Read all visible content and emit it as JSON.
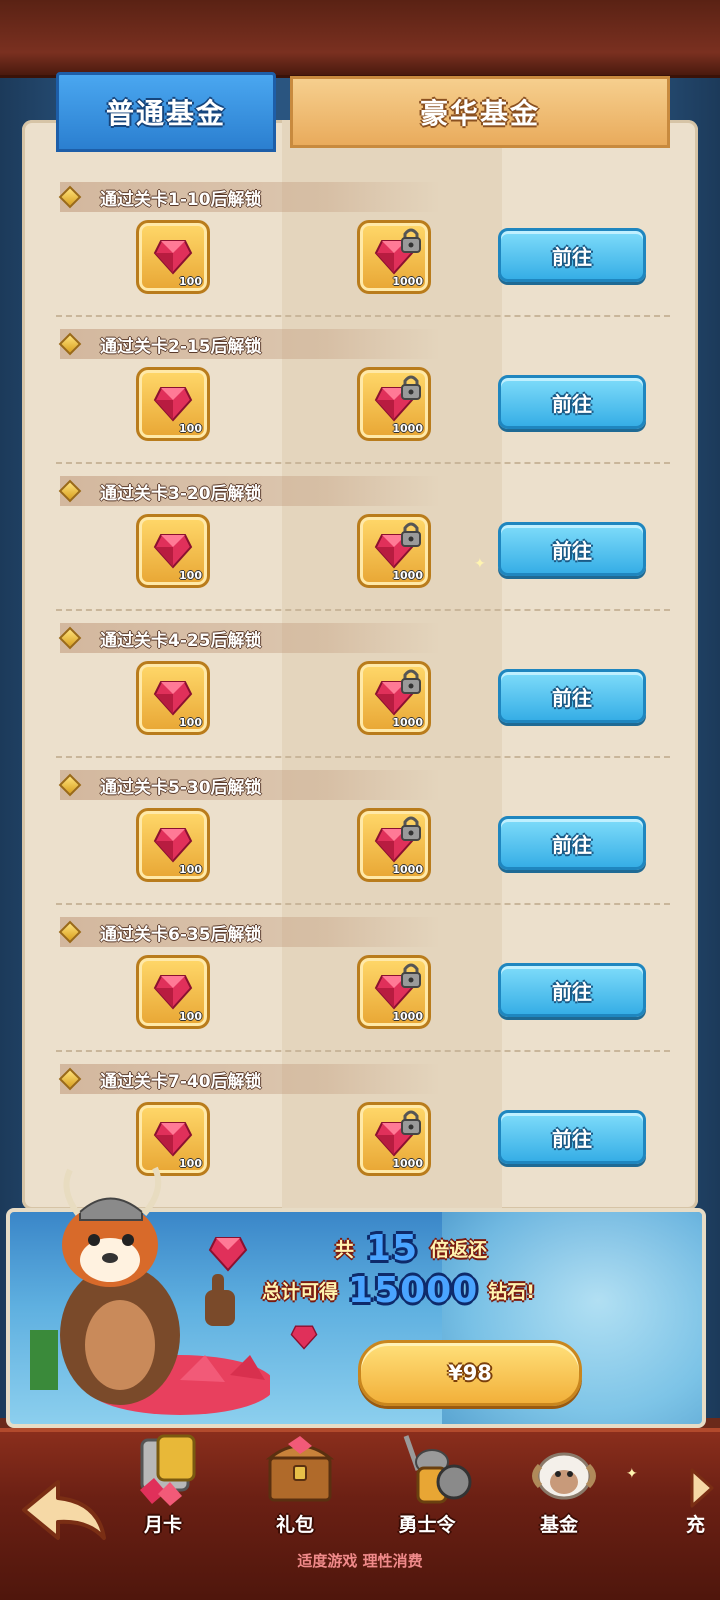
{
  "tabs": {
    "normal": "普通基金",
    "deluxe": "豪华基金"
  },
  "rows": [
    {
      "title": "通过关卡1-10后解锁",
      "basic_amount": "100",
      "deluxe_amount": "1000",
      "button": "前往"
    },
    {
      "title": "通过关卡2-15后解锁",
      "basic_amount": "100",
      "deluxe_amount": "1000",
      "button": "前往"
    },
    {
      "title": "通过关卡3-20后解锁",
      "basic_amount": "100",
      "deluxe_amount": "1000",
      "button": "前往"
    },
    {
      "title": "通过关卡4-25后解锁",
      "basic_amount": "100",
      "deluxe_amount": "1000",
      "button": "前往"
    },
    {
      "title": "通过关卡5-30后解锁",
      "basic_amount": "100",
      "deluxe_amount": "1000",
      "button": "前往"
    },
    {
      "title": "通过关卡6-35后解锁",
      "basic_amount": "100",
      "deluxe_amount": "1000",
      "button": "前往"
    },
    {
      "title": "通过关卡7-40后解锁",
      "basic_amount": "100",
      "deluxe_amount": "1000",
      "button": "前往"
    }
  ],
  "promo": {
    "prefix": "共",
    "multiplier": "15",
    "multiplier_suffix": "倍返还",
    "total_prefix": "总计可得",
    "total": "15000",
    "total_suffix": "钻石!",
    "price": "¥98"
  },
  "nav": {
    "items": [
      {
        "label": "月卡",
        "icon": "month-card-icon"
      },
      {
        "label": "礼包",
        "icon": "gift-chest-icon"
      },
      {
        "label": "勇士令",
        "icon": "warrior-pass-icon"
      },
      {
        "label": "基金",
        "icon": "fund-ram-icon"
      }
    ],
    "partial_label": "充"
  },
  "footer": "适度游戏 理性消费",
  "colors": {
    "go_button": "#36aee6",
    "price_button": "#f2b03a",
    "gem": "#e0305a"
  }
}
